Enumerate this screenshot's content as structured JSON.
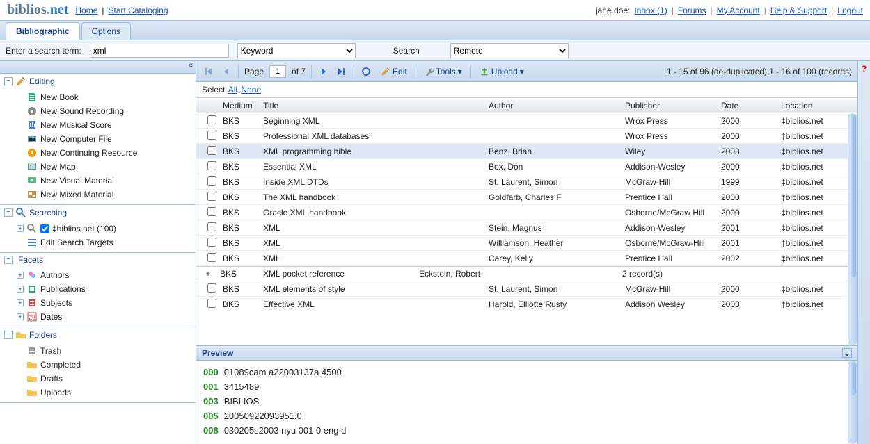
{
  "header": {
    "logo_main": "biblios",
    "logo_suffix": ".net",
    "nav": {
      "home": "Home",
      "start_cataloging": "Start Cataloging"
    },
    "user_prefix": "jane.doe:",
    "links": {
      "inbox": "Inbox (1)",
      "forums": "Forums",
      "account": "My Account",
      "help": "Help & Support",
      "logout": "Logout"
    }
  },
  "tabs": {
    "bibliographic": "Bibliographic",
    "options": "Options"
  },
  "search": {
    "label": "Enter a search term:",
    "value": "xml",
    "type_options": [
      "Keyword"
    ],
    "type_selected": "Keyword",
    "button": "Search",
    "scope_options": [
      "Remote"
    ],
    "scope_selected": "Remote"
  },
  "sidebar": {
    "editing": {
      "title": "Editing",
      "items": [
        "New Book",
        "New Sound Recording",
        "New Musical Score",
        "New Computer File",
        "New Continuing Resource",
        "New Map",
        "New Visual Material",
        "New Mixed Material"
      ]
    },
    "searching": {
      "title": "Searching",
      "target": "‡biblios.net (100)",
      "edit_targets": "Edit Search Targets"
    },
    "facets": {
      "title": "Facets",
      "items": [
        "Authors",
        "Publications",
        "Subjects",
        "Dates"
      ]
    },
    "folders": {
      "title": "Folders",
      "items": [
        "Trash",
        "Completed",
        "Drafts",
        "Uploads"
      ]
    }
  },
  "toolbar": {
    "page_label": "Page",
    "page_value": "1",
    "page_total": "of 7",
    "edit": "Edit",
    "tools": "Tools",
    "upload": "Upload",
    "status": "1 - 15 of 96 (de-duplicated) 1 - 16 of 100 (records)"
  },
  "select_bar": {
    "prefix": "Select ",
    "all": "All",
    "none": "None"
  },
  "grid": {
    "headers": {
      "medium": "Medium",
      "title": "Title",
      "author": "Author",
      "publisher": "Publisher",
      "date": "Date",
      "location": "Location"
    },
    "rows": [
      {
        "medium": "BKS",
        "title": "Beginning XML",
        "author": "",
        "publisher": "Wrox Press",
        "date": "2000",
        "location": "‡biblios.net"
      },
      {
        "medium": "BKS",
        "title": "Professional XML databases",
        "author": "",
        "publisher": "Wrox Press",
        "date": "2000",
        "location": "‡biblios.net"
      },
      {
        "medium": "BKS",
        "title": "XML programming bible",
        "author": "Benz, Brian",
        "publisher": "Wiley",
        "date": "2003",
        "location": "‡biblios.net",
        "sel": true
      },
      {
        "medium": "BKS",
        "title": "Essential XML",
        "author": "Box, Don",
        "publisher": "Addison-Wesley",
        "date": "2000",
        "location": "‡biblios.net"
      },
      {
        "medium": "BKS",
        "title": "Inside XML DTDs",
        "author": "St. Laurent, Simon",
        "publisher": "McGraw-Hill",
        "date": "1999",
        "location": "‡biblios.net"
      },
      {
        "medium": "BKS",
        "title": "The XML handbook",
        "author": "Goldfarb, Charles F",
        "publisher": "Prentice Hall",
        "date": "2000",
        "location": "‡biblios.net"
      },
      {
        "medium": "BKS",
        "title": "Oracle XML handbook",
        "author": "",
        "publisher": "Osborne/McGraw Hill",
        "date": "2000",
        "location": "‡biblios.net"
      },
      {
        "medium": "BKS",
        "title": "XML",
        "author": "Stein, Magnus",
        "publisher": "Addison-Wesley",
        "date": "2001",
        "location": "‡biblios.net"
      },
      {
        "medium": "BKS",
        "title": "XML",
        "author": "Williamson, Heather",
        "publisher": "Osborne/McGraw-Hill",
        "date": "2001",
        "location": "‡biblios.net"
      },
      {
        "medium": "BKS",
        "title": "XML",
        "author": "Carey, Kelly",
        "publisher": "Prentice Hall",
        "date": "2002",
        "location": "‡biblios.net"
      }
    ],
    "group": {
      "medium": "BKS",
      "title": "XML pocket reference",
      "author": "Eckstein, Robert",
      "count": "2 record(s)"
    },
    "rows2": [
      {
        "medium": "BKS",
        "title": "XML elements of style",
        "author": "St. Laurent, Simon",
        "publisher": "McGraw-Hill",
        "date": "2000",
        "location": "‡biblios.net"
      },
      {
        "medium": "BKS",
        "title": "Effective XML",
        "author": "Harold, Elliotte Rusty",
        "publisher": "Addison Wesley",
        "date": "2003",
        "location": "‡biblios.net"
      }
    ]
  },
  "preview": {
    "title": "Preview",
    "lines": [
      {
        "tag": "000",
        "val": "01089cam a22003137a 4500"
      },
      {
        "tag": "001",
        "val": "3415489"
      },
      {
        "tag": "003",
        "val": "BIBLIOS"
      },
      {
        "tag": "005",
        "val": "20050922093951.0"
      },
      {
        "tag": "008",
        "val": "030205s2003 nyu 001 0 eng d"
      }
    ]
  },
  "help_glyph": "?"
}
